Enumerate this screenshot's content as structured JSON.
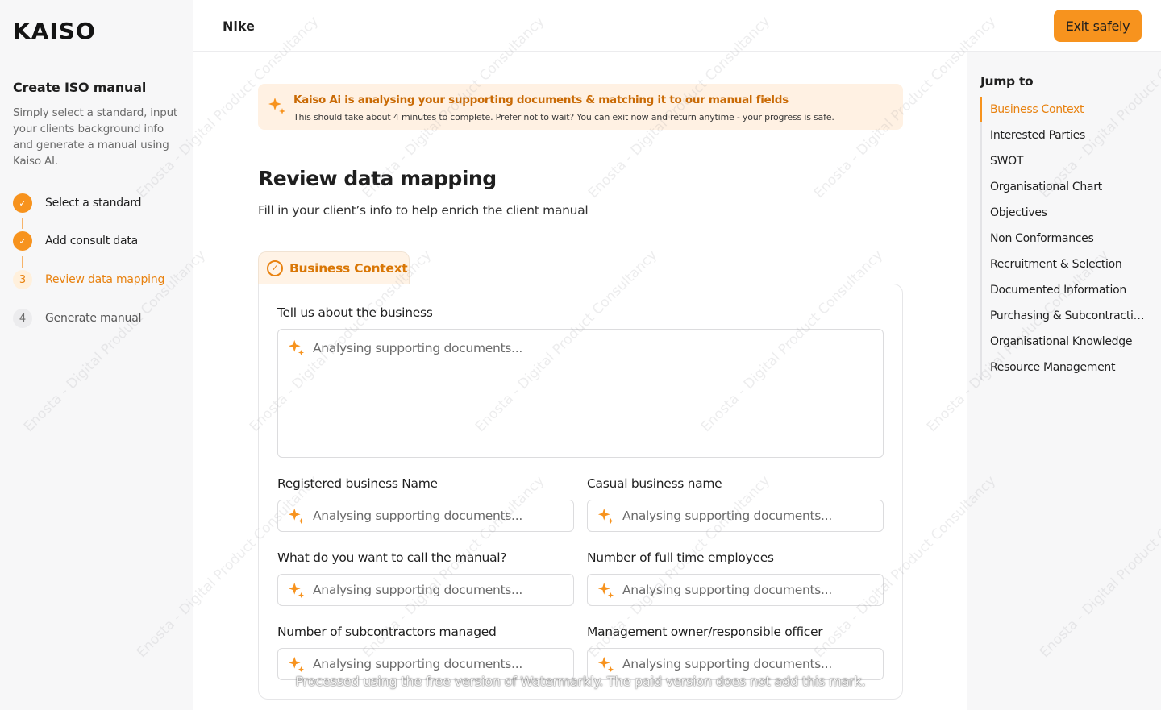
{
  "brand": {
    "logo": "KAISO"
  },
  "sidebar": {
    "title": "Create ISO manual",
    "description": "Simply select a standard, input your clients background info and generate  a manual using Kaiso AI.",
    "steps": [
      {
        "marker": "✓",
        "label": "Select a standard",
        "state": "done"
      },
      {
        "marker": "✓",
        "label": "Add consult data",
        "state": "done"
      },
      {
        "marker": "3",
        "label": "Review data mapping",
        "state": "current"
      },
      {
        "marker": "4",
        "label": "Generate manual",
        "state": "todo"
      }
    ]
  },
  "header": {
    "client_name": "Nike",
    "exit_label": "Exit safely"
  },
  "banner": {
    "title": "Kaiso Ai is analysing your supporting documents & matching it to our manual fields",
    "subtitle": "This should take about 4 minutes to complete. Prefer not to wait? You can exit now and return anytime - your progress is safe."
  },
  "main": {
    "title": "Review data mapping",
    "subtitle": "Fill in your client’s info to help enrich the client manual",
    "section_tab": "Business Context",
    "fields": {
      "about": {
        "label": "Tell us about the business",
        "placeholder": "Analysing supporting documents..."
      },
      "registered_name": {
        "label": "Registered business Name",
        "placeholder": "Analysing supporting documents..."
      },
      "casual_name": {
        "label": "Casual business name",
        "placeholder": "Analysing supporting documents..."
      },
      "manual_name": {
        "label": "What do you want to call the manual?",
        "placeholder": "Analysing supporting documents..."
      },
      "employees": {
        "label": "Number of full time employees",
        "placeholder": "Analysing supporting documents..."
      },
      "subcontractors": {
        "label": "Number of subcontractors managed",
        "placeholder": "Analysing supporting documents..."
      },
      "owner": {
        "label": "Management owner/responsible officer",
        "placeholder": "Analysing supporting documents..."
      }
    }
  },
  "jump_to": {
    "title": "Jump to",
    "items": [
      "Business Context",
      "Interested Parties",
      "SWOT",
      "Organisational Chart",
      "Objectives",
      "Non Conformances",
      "Recruitment & Selection",
      "Documented Information",
      "Purchasing & Subcontracting",
      "Organisational Knowledge",
      "Resource Management"
    ],
    "active_index": 0
  },
  "watermarks": {
    "diagonal_text": "Enosta - Digital Product Consultancy",
    "footer_text": "Processed using the free version of Watermarkly. The paid version does not add this mark."
  },
  "colors": {
    "accent": "#f7931e",
    "accent_text": "#e88210",
    "banner_bg": "#fff1e3"
  }
}
